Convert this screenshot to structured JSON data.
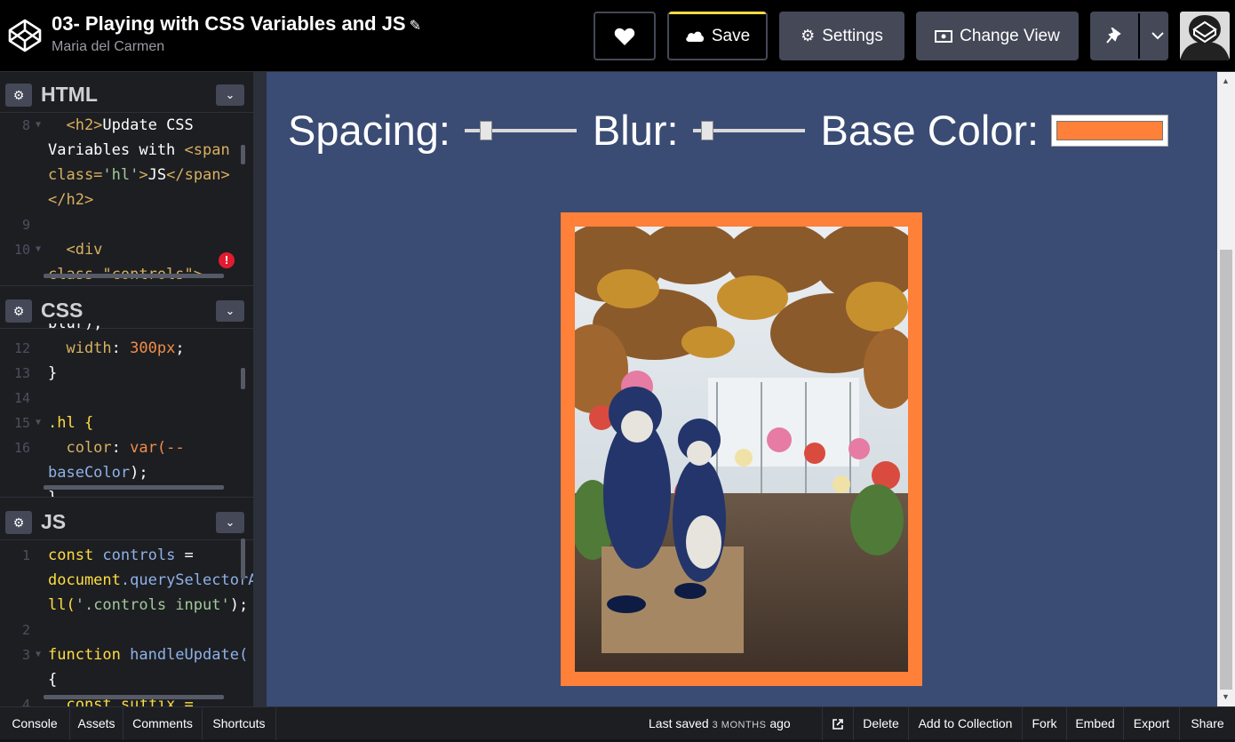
{
  "header": {
    "title": "03- Playing with CSS Variables and JS",
    "author": "Maria del Carmen",
    "save_label": "Save",
    "settings_label": "Settings",
    "change_view_label": "Change View"
  },
  "panels": {
    "html": {
      "name": "HTML",
      "lines": [
        {
          "n": "8",
          "fold": true
        },
        {
          "n": ""
        },
        {
          "n": ""
        },
        {
          "n": ""
        },
        {
          "n": "9"
        },
        {
          "n": "10",
          "fold": true
        },
        {
          "n": ""
        }
      ]
    },
    "css": {
      "name": "CSS"
    },
    "js": {
      "name": "JS"
    }
  },
  "code": {
    "html_l1_a": "  <h2>",
    "html_l1_b": "Update CSS",
    "html_l2_a": "Variables with ",
    "html_l2_b": "<span",
    "html_l3_a": "class=",
    "html_l3_b": "'hl'",
    "html_l3_c": ">",
    "html_l3_d": "JS",
    "html_l3_e": "</span>",
    "html_l4": "</h2>",
    "html_l6": "  <div",
    "html_l7": "class \"controls\">",
    "css_l0": "blur);",
    "css_l1_a": "  width",
    "css_l1_b": ": ",
    "css_l1_c": "300px",
    "css_l1_d": ";",
    "css_l2": "}",
    "css_l4": ".hl {",
    "css_l5_a": "  color",
    "css_l5_b": ": ",
    "css_l5_c": "var(--",
    "css_l6_a": "baseColor",
    "css_l6_b": ");",
    "css_l7": "}",
    "js_l1_a": "const ",
    "js_l1_b": "controls",
    "js_l1_c": " =",
    "js_l2_a": "document",
    "js_l2_b": ".querySelectorA",
    "js_l3_a": "ll(",
    "js_l3_b": "'.controls input'",
    "js_l3_c": ");",
    "js_l5_a": "function ",
    "js_l5_b": "handleUpdate(",
    "js_l6": "{",
    "js_l7": "  const suffix ="
  },
  "line_numbers": {
    "html": [
      "8",
      "9",
      "10"
    ],
    "css": [
      "12",
      "13",
      "14",
      "15",
      "16"
    ],
    "js": [
      "1",
      "2",
      "3",
      "4"
    ]
  },
  "preview": {
    "spacing_label": "Spacing:",
    "blur_label": "Blur:",
    "base_color_label": "Base Color:",
    "spacing_value": 0.15,
    "blur_value": 0.08,
    "base_color": "#ff8038",
    "background": "#3a4b74"
  },
  "footer": {
    "console": "Console",
    "assets": "Assets",
    "comments": "Comments",
    "shortcuts": "Shortcuts",
    "last_saved_prefix": "Last saved ",
    "last_saved_time": "3 MONTHS",
    "last_saved_suffix": " ago",
    "delete": "Delete",
    "add_to_collection": "Add to Collection",
    "fork": "Fork",
    "embed": "Embed",
    "export": "Export",
    "share": "Share"
  },
  "icons": {
    "logo": "codepen-logo-icon",
    "heart": "heart-icon",
    "cloud": "cloud-icon",
    "gear": "gear-icon",
    "view": "change-view-icon",
    "pin": "pin-icon",
    "chevron": "chevron-down-icon",
    "external": "external-link-icon",
    "error": "error-icon"
  },
  "colors": {
    "accent_yellow": "#ffdd40",
    "button_bg": "#444857",
    "error_red": "#e11c2f"
  }
}
